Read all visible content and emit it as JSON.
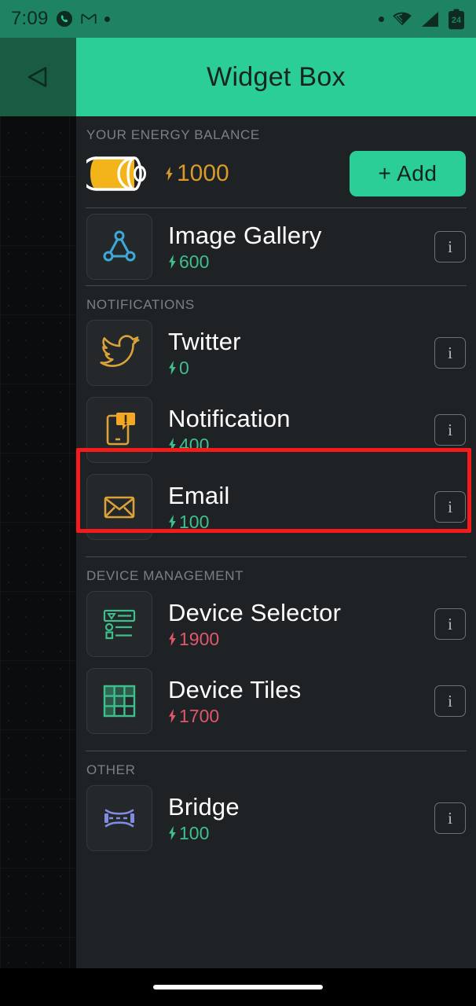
{
  "status_bar": {
    "time": "7:09",
    "battery_level": "24",
    "left_icons": [
      "phone-circle-icon",
      "gmail-icon",
      "dot-icon"
    ],
    "right_icons": [
      "dot-icon",
      "wifi-icon",
      "cellular-signal-icon",
      "battery-icon"
    ]
  },
  "header": {
    "title": "Widget Box",
    "back_icon": "back-triangle-icon",
    "bg_color": "#2BCE96"
  },
  "balance": {
    "label": "YOUR ENERGY BALANCE",
    "amount": "1000",
    "amount_color": "#D79A2B",
    "battery_icon": "energy-battery-icon",
    "add_button": "+ Add"
  },
  "sections": [
    {
      "label": "",
      "items": [
        {
          "name": "Image Gallery",
          "cost": "600",
          "affordable": true,
          "icon": "image-gallery-triangle-icon",
          "icon_color": "#3EA9D6",
          "info_label": "i"
        }
      ]
    },
    {
      "label": "NOTIFICATIONS",
      "items": [
        {
          "name": "Twitter",
          "cost": "0",
          "affordable": true,
          "icon": "twitter-bird-icon",
          "icon_color": "#D9A33A",
          "info_label": "i"
        },
        {
          "name": "Notification",
          "cost": "400",
          "affordable": true,
          "icon": "notification-phone-alert-icon",
          "icon_color": "#D9A33A",
          "info_label": "i",
          "highlighted": true
        },
        {
          "name": "Email",
          "cost": "100",
          "affordable": true,
          "icon": "email-envelope-icon",
          "icon_color": "#D9A33A",
          "info_label": "i"
        }
      ]
    },
    {
      "label": "DEVICE MANAGEMENT",
      "items": [
        {
          "name": "Device Selector",
          "cost": "1900",
          "affordable": false,
          "icon": "device-selector-list-icon",
          "icon_color": "#3FBF8C",
          "info_label": "i"
        },
        {
          "name": "Device Tiles",
          "cost": "1700",
          "affordable": false,
          "icon": "device-tiles-grid-icon",
          "icon_color": "#3FBF8C",
          "info_label": "i"
        }
      ]
    },
    {
      "label": "OTHER",
      "items": [
        {
          "name": "Bridge",
          "cost": "100",
          "affordable": true,
          "icon": "bridge-icon",
          "icon_color": "#7F8CE0",
          "info_label": "i"
        }
      ]
    }
  ],
  "colors": {
    "accent_green": "#2BCE96",
    "cost_ok": "#3FBF8C",
    "cost_bad": "#E0576B",
    "highlight_red": "#F51B1B",
    "panel_bg": "#1f2224"
  }
}
